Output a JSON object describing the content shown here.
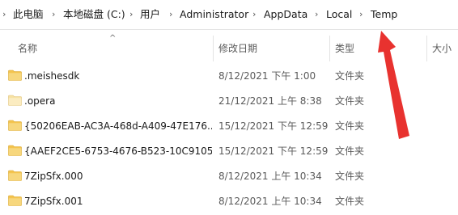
{
  "breadcrumb": [
    "此电脑",
    "本地磁盘 (C:)",
    "用户",
    "Administrator",
    "AppData",
    "Local",
    "Temp"
  ],
  "columns": {
    "name": "名称",
    "modified": "修改日期",
    "type": "类型",
    "size": "大小"
  },
  "files": [
    {
      "name": ".meishesdk",
      "modified": "8/12/2021 下午 1:00",
      "type": "文件夹",
      "icon": "folder-icon"
    },
    {
      "name": ".opera",
      "modified": "21/12/2021 上午 8:38",
      "type": "文件夹",
      "icon": "folder-icon"
    },
    {
      "name": "{50206EAB-AC3A-468d-A409-47E176...",
      "modified": "15/12/2021 下午 12:59",
      "type": "文件夹",
      "icon": "folder-icon"
    },
    {
      "name": "{AAEF2CE5-6753-4676-B523-10C9105...",
      "modified": "15/12/2021 下午 12:59",
      "type": "文件夹",
      "icon": "folder-icon"
    },
    {
      "name": "7ZipSfx.000",
      "modified": "8/12/2021 上午 10:34",
      "type": "文件夹",
      "icon": "folder-icon"
    },
    {
      "name": "7ZipSfx.001",
      "modified": "8/12/2021 上午 10:34",
      "type": "文件夹",
      "icon": "folder-icon"
    }
  ],
  "colors": {
    "folder": "#f4c44e",
    "folder_light": "#f7d77d",
    "annotation_arrow": "#e8322f"
  }
}
